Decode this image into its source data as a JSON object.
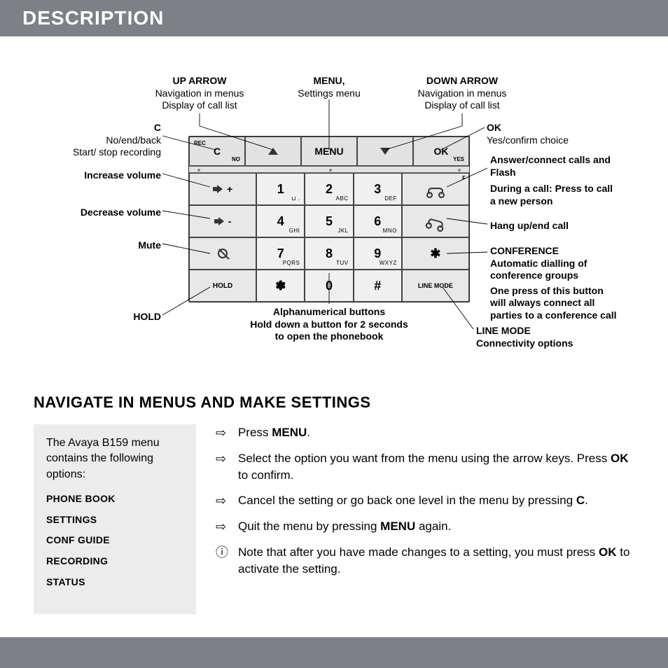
{
  "title": "DESCRIPTION",
  "callouts": {
    "up_arrow": {
      "title": "UP ARROW",
      "l1": "Navigation in menus",
      "l2": "Display of call list"
    },
    "menu": {
      "title": "MENU,",
      "l1": "Settings menu"
    },
    "down_arrow": {
      "title": "DOWN ARROW",
      "l1": "Navigation in menus",
      "l2": "Display of call list"
    },
    "c": {
      "title": "C",
      "l1": "No/end/back",
      "l2": "Start/ stop recording"
    },
    "ok": {
      "title": "OK",
      "l1": "Yes/confirm choice"
    },
    "vol_up": "Increase volume",
    "vol_down": "Decrease volume",
    "mute": "Mute",
    "hold": "HOLD",
    "alpha": {
      "l1": "Alphanumerical buttons",
      "l2": "Hold down a button for 2 seconds",
      "l3": "to open the phonebook"
    },
    "answer": {
      "l1": "Answer/connect calls and",
      "l2": "Flash",
      "l3": "During a call: Press to call",
      "l4": "a new person"
    },
    "hangup": "Hang up/end call",
    "conference": {
      "title": "CONFERENCE",
      "l1": "Automatic dialling of",
      "l2": "conference groups",
      "l3": "One press of this button",
      "l4": "will always connect all",
      "l5": "parties to a conference call"
    },
    "linemode": {
      "title": "LINE MODE",
      "l1": "Connectivity options"
    }
  },
  "keypad": {
    "toprow": {
      "c": "C",
      "c_sub": "NO",
      "rec": "REC",
      "menu": "MENU",
      "ok": "OK",
      "ok_sub": "YES"
    },
    "keys": {
      "1": {
        "n": "1",
        "s": "⊔ ."
      },
      "2": {
        "n": "2",
        "s": "ABC"
      },
      "3": {
        "n": "3",
        "s": "DEF"
      },
      "4": {
        "n": "4",
        "s": "GHI"
      },
      "5": {
        "n": "5",
        "s": "JKL"
      },
      "6": {
        "n": "6",
        "s": "MNO"
      },
      "7": {
        "n": "7",
        "s": "PQRS"
      },
      "8": {
        "n": "8",
        "s": "TUV"
      },
      "9": {
        "n": "9",
        "s": "WXYZ"
      },
      "star": {
        "n": "✽"
      },
      "0": {
        "n": "0"
      },
      "hash": {
        "n": "#"
      }
    },
    "side": {
      "plus": "+",
      "minus": "-",
      "hold": "HOLD",
      "linemode": "LINE MODE",
      "f": "F"
    }
  },
  "section2": {
    "heading": "NAVIGATE IN MENUS AND MAKE SETTINGS",
    "intro": "The Avaya B159 menu contains the following options:",
    "options": [
      "PHONE BOOK",
      "SETTINGS",
      "CONF GUIDE",
      "RECORDING",
      "STATUS"
    ],
    "steps": [
      {
        "icon": "⇨",
        "html": "Press <b>MENU</b>."
      },
      {
        "icon": "⇨",
        "html": "Select the option you want from the menu using the arrow keys. Press <b>OK</b> to confirm."
      },
      {
        "icon": "⇨",
        "html": "Cancel the setting or go back one level in the menu by pressing <b>C</b>."
      },
      {
        "icon": "⇨",
        "html": "Quit the menu by pressing <b>MENU</b> again."
      },
      {
        "icon": "ⓘ",
        "html": "Note that after you have made changes to a setting, you must press <b>OK</b> to activate the setting."
      }
    ]
  }
}
